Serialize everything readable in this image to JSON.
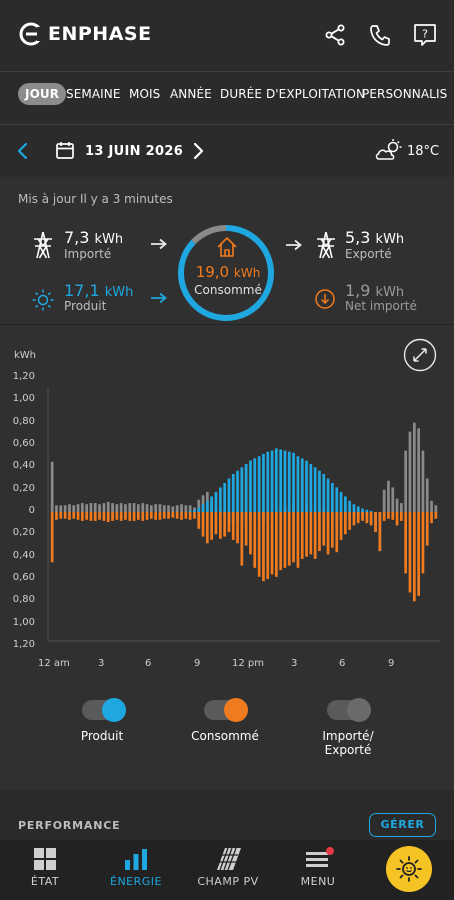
{
  "header": {
    "brand": "ENPHASE",
    "icons": [
      "share-icon",
      "phone-icon",
      "help-icon"
    ]
  },
  "tabs": [
    {
      "label": "JOUR",
      "active": true
    },
    {
      "label": "SEMAINE",
      "active": false
    },
    {
      "label": "MOIS",
      "active": false
    },
    {
      "label": "ANNÉE",
      "active": false
    },
    {
      "label": "DURÉE D'EXPLOITATION",
      "active": false
    },
    {
      "label": "PERSONNALIS",
      "active": false
    }
  ],
  "date_bar": {
    "date": "13 JUIN 2026",
    "temperature": "18°C",
    "weather_icon": "partly-cloudy-icon"
  },
  "summary": {
    "updated": "Mis à jour Il y a 3 minutes",
    "imported": {
      "value": "7,3",
      "unit": "kWh",
      "label": "Importé"
    },
    "produced": {
      "value": "17,1",
      "unit": "kWh",
      "label": "Produit"
    },
    "consumed": {
      "value": "19,0",
      "unit": "kWh",
      "label": "Consommé"
    },
    "exported": {
      "value": "5,3",
      "unit": "kWh",
      "label": "Exporté"
    },
    "net_imported": {
      "value": "1,9",
      "unit": "kWh",
      "label": "Net importé"
    }
  },
  "chart_data": {
    "type": "bar",
    "ylabel": "kWh",
    "ylim": [
      -1.2,
      1.2
    ],
    "y_ticks": [
      "1,20",
      "1,00",
      "0,80",
      "0,60",
      "0,40",
      "0,20",
      "0",
      "0,20",
      "0,40",
      "0,60",
      "0,80",
      "1,00",
      "1,20"
    ],
    "x_ticks": [
      "12 am",
      "3",
      "6",
      "9",
      "12 pm",
      "3",
      "6",
      "9"
    ],
    "series": [
      {
        "name": "Produit",
        "values": [
          0,
          0,
          0,
          0,
          0,
          0,
          0,
          0,
          0,
          0,
          0,
          0,
          0,
          0,
          0,
          0,
          0,
          0,
          0,
          0,
          0,
          0,
          0,
          0,
          0,
          0,
          0,
          0,
          0,
          0,
          0,
          0,
          0.01,
          0.02,
          0.04,
          0.07,
          0.1,
          0.14,
          0.18,
          0.22,
          0.26,
          0.3,
          0.34,
          0.37,
          0.4,
          0.43,
          0.46,
          0.48,
          0.5,
          0.52,
          0.54,
          0.55,
          0.57,
          0.56,
          0.55,
          0.54,
          0.53,
          0.5,
          0.48,
          0.46,
          0.43,
          0.4,
          0.37,
          0.34,
          0.3,
          0.26,
          0.22,
          0.18,
          0.14,
          0.1,
          0.07,
          0.05,
          0.03,
          0.02,
          0.01,
          0,
          0,
          0,
          0,
          0,
          0,
          0,
          0,
          0,
          0,
          0,
          0,
          0,
          0,
          0
        ]
      },
      {
        "name": "Consommé",
        "values": [
          -0.45,
          -0.07,
          -0.06,
          -0.06,
          -0.07,
          -0.06,
          -0.07,
          -0.08,
          -0.07,
          -0.08,
          -0.08,
          -0.07,
          -0.08,
          -0.09,
          -0.08,
          -0.07,
          -0.08,
          -0.07,
          -0.08,
          -0.08,
          -0.07,
          -0.08,
          -0.07,
          -0.06,
          -0.07,
          -0.07,
          -0.06,
          -0.06,
          -0.05,
          -0.06,
          -0.07,
          -0.06,
          -0.07,
          -0.06,
          -0.15,
          -0.22,
          -0.28,
          -0.25,
          -0.2,
          -0.24,
          -0.22,
          -0.18,
          -0.25,
          -0.28,
          -0.48,
          -0.3,
          -0.38,
          -0.5,
          -0.58,
          -0.62,
          -0.6,
          -0.56,
          -0.58,
          -0.52,
          -0.5,
          -0.48,
          -0.45,
          -0.5,
          -0.42,
          -0.4,
          -0.38,
          -0.42,
          -0.35,
          -0.3,
          -0.38,
          -0.32,
          -0.36,
          -0.25,
          -0.2,
          -0.16,
          -0.12,
          -0.1,
          -0.08,
          -0.1,
          -0.12,
          -0.18,
          -0.35,
          -0.08,
          -0.06,
          -0.07,
          -0.12,
          -0.08,
          -0.55,
          -0.72,
          -0.8,
          -0.75,
          -0.55,
          -0.3,
          -0.1,
          -0.06
        ]
      },
      {
        "name": "Importé/ Exporté",
        "values": [
          0.45,
          0.06,
          0.06,
          0.06,
          0.07,
          0.06,
          0.07,
          0.08,
          0.07,
          0.08,
          0.08,
          0.07,
          0.08,
          0.09,
          0.08,
          0.07,
          0.08,
          0.07,
          0.08,
          0.08,
          0.07,
          0.08,
          0.07,
          0.06,
          0.07,
          0.07,
          0.06,
          0.06,
          0.05,
          0.06,
          0.07,
          0.06,
          0.06,
          0.04,
          0.11,
          0.15,
          0.18,
          0.11,
          0.02,
          0.02,
          -0.04,
          -0.12,
          -0.09,
          -0.09,
          -0.08,
          -0.13,
          -0.08,
          -0.02,
          -0.08,
          -0.1,
          -0.06,
          -0.01,
          -0.01,
          0.04,
          0.05,
          0.06,
          0.08,
          0,
          0.06,
          0.06,
          0.05,
          -0.02,
          0.02,
          0.04,
          -0.08,
          -0.06,
          -0.14,
          -0.07,
          -0.06,
          -0.06,
          -0.05,
          -0.05,
          -0.05,
          -0.08,
          -0.11,
          -0.18,
          -0.35,
          0.2,
          0.28,
          0.22,
          0.12,
          0.08,
          0.55,
          0.72,
          0.8,
          0.75,
          0.55,
          0.3,
          0.1,
          0.06
        ]
      }
    ]
  },
  "legend": [
    {
      "label": "Produit",
      "color": "#1ea7e0"
    },
    {
      "label": "Consommé",
      "color": "#f07b1f"
    },
    {
      "label": "Importé/ Exporté",
      "color": "#6a6a6a"
    }
  ],
  "performance": {
    "title": "PERFORMANCE",
    "manage_label": "GÉRER"
  },
  "nav": [
    {
      "label": "ÉTAT",
      "icon": "grid-icon",
      "active": false
    },
    {
      "label": "ÉNERGIE",
      "icon": "bar-chart-icon",
      "active": true
    },
    {
      "label": "CHAMP PV",
      "icon": "solar-panel-icon",
      "active": false
    },
    {
      "label": "MENU",
      "icon": "menu-icon",
      "active": false
    }
  ],
  "fab_icon": "sun-icon",
  "colors": {
    "produced": "#1ea7e0",
    "consumed": "#f07b1f",
    "grid": "#8a8a8a",
    "accent_yellow": "#f6c325"
  }
}
